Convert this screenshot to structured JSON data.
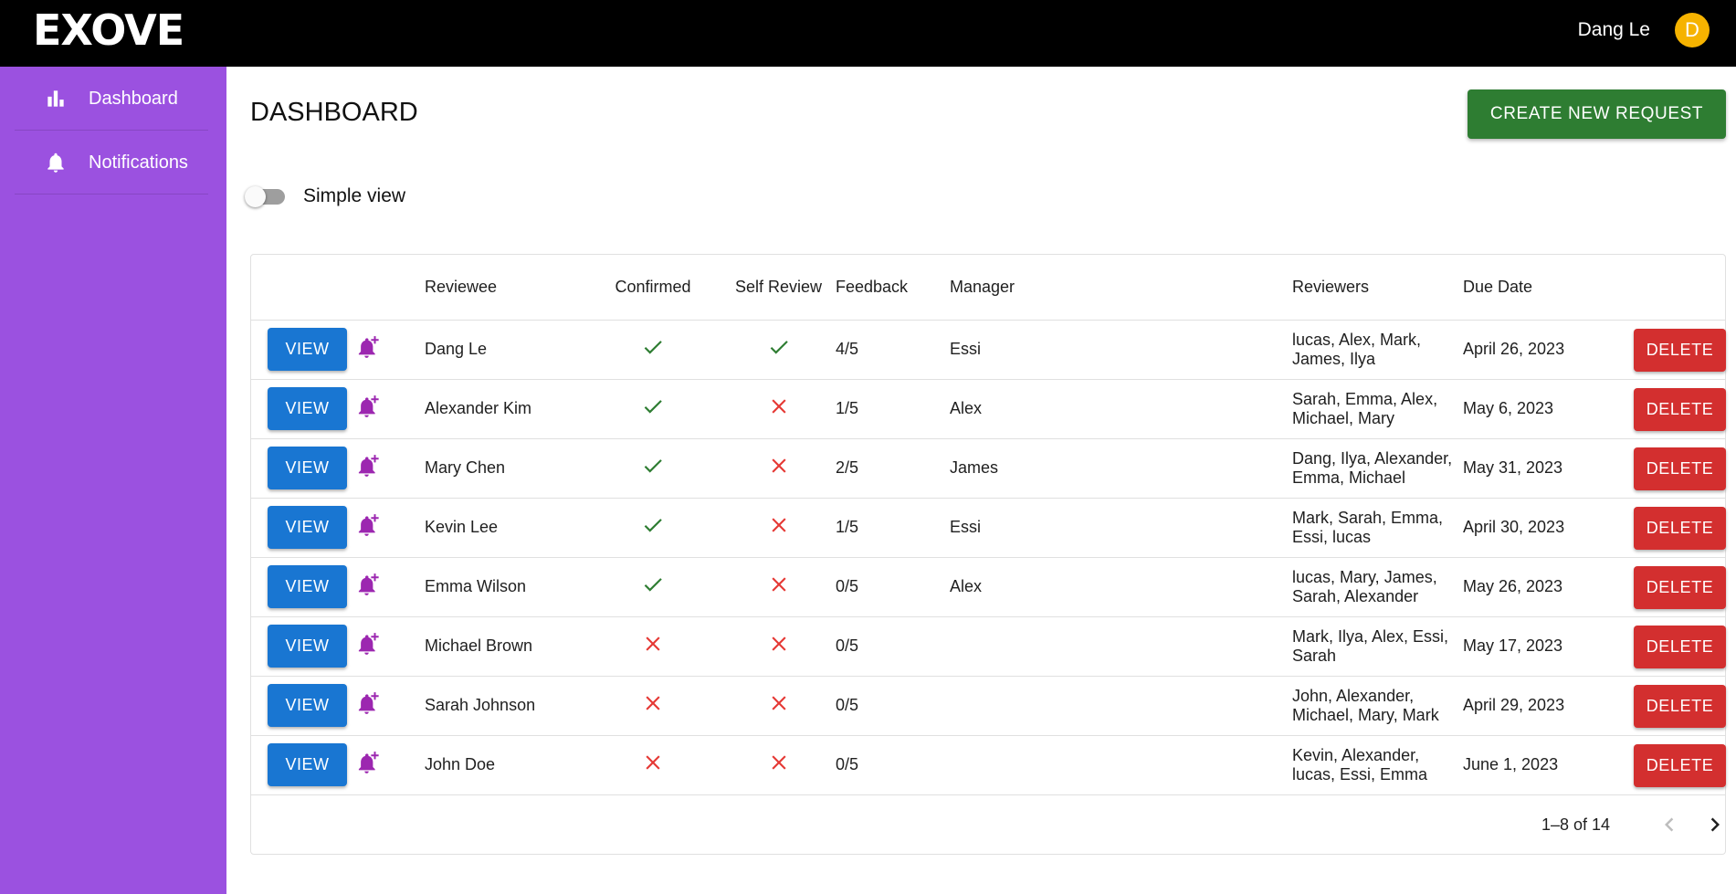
{
  "header": {
    "logo_text": "EXOVE",
    "user_name": "Dang Le",
    "avatar_initial": "D",
    "avatar_color": "#f6b300"
  },
  "sidebar": {
    "items": [
      {
        "label": "Dashboard",
        "icon": "bar-chart-icon"
      },
      {
        "label": "Notifications",
        "icon": "bell-icon"
      }
    ]
  },
  "main": {
    "title": "DASHBOARD",
    "create_button": "CREATE NEW REQUEST",
    "simple_view_label": "Simple view",
    "simple_view_on": false
  },
  "table": {
    "columns": [
      "Reviewee",
      "Confirmed",
      "Self Review",
      "Feedback",
      "Manager",
      "Reviewers",
      "Due Date"
    ],
    "view_label": "VIEW",
    "delete_label": "DELETE",
    "rows": [
      {
        "reviewee": "Dang Le",
        "confirmed": true,
        "self_review": true,
        "feedback": "4/5",
        "manager": "Essi",
        "reviewers": "lucas, Alex, Mark, James, Ilya",
        "due_date": "April 26, 2023"
      },
      {
        "reviewee": "Alexander Kim",
        "confirmed": true,
        "self_review": false,
        "feedback": "1/5",
        "manager": "Alex",
        "reviewers": "Sarah, Emma, Alex, Michael, Mary",
        "due_date": "May 6, 2023"
      },
      {
        "reviewee": "Mary Chen",
        "confirmed": true,
        "self_review": false,
        "feedback": "2/5",
        "manager": "James",
        "reviewers": "Dang, Ilya, Alexander, Emma, Michael",
        "due_date": "May 31, 2023"
      },
      {
        "reviewee": "Kevin Lee",
        "confirmed": true,
        "self_review": false,
        "feedback": "1/5",
        "manager": "Essi",
        "reviewers": "Mark, Sarah, Emma, Essi, lucas",
        "due_date": "April 30, 2023"
      },
      {
        "reviewee": "Emma Wilson",
        "confirmed": true,
        "self_review": false,
        "feedback": "0/5",
        "manager": "Alex",
        "reviewers": "lucas, Mary, James, Sarah, Alexander",
        "due_date": "May 26, 2023"
      },
      {
        "reviewee": "Michael Brown",
        "confirmed": false,
        "self_review": false,
        "feedback": "0/5",
        "manager": "",
        "reviewers": "Mark, Ilya, Alex, Essi, Sarah",
        "due_date": "May 17, 2023"
      },
      {
        "reviewee": "Sarah Johnson",
        "confirmed": false,
        "self_review": false,
        "feedback": "0/5",
        "manager": "",
        "reviewers": "John, Alexander, Michael, Mary, Mark",
        "due_date": "April 29, 2023"
      },
      {
        "reviewee": "John Doe",
        "confirmed": false,
        "self_review": false,
        "feedback": "0/5",
        "manager": "",
        "reviewers": "Kevin, Alexander, lucas, Essi, Emma",
        "due_date": "June 1, 2023"
      }
    ]
  },
  "pagination": {
    "range_text": "1–8 of 14",
    "prev_enabled": false,
    "next_enabled": true
  },
  "colors": {
    "topbar": "#000000",
    "sidebar": "#9b51e0",
    "create_button": "#2e7d32",
    "view_button": "#1976d2",
    "delete_button": "#d32f2f",
    "bell_icon": "#9c27b0",
    "check": "#2e7d32",
    "cross": "#e53935"
  }
}
